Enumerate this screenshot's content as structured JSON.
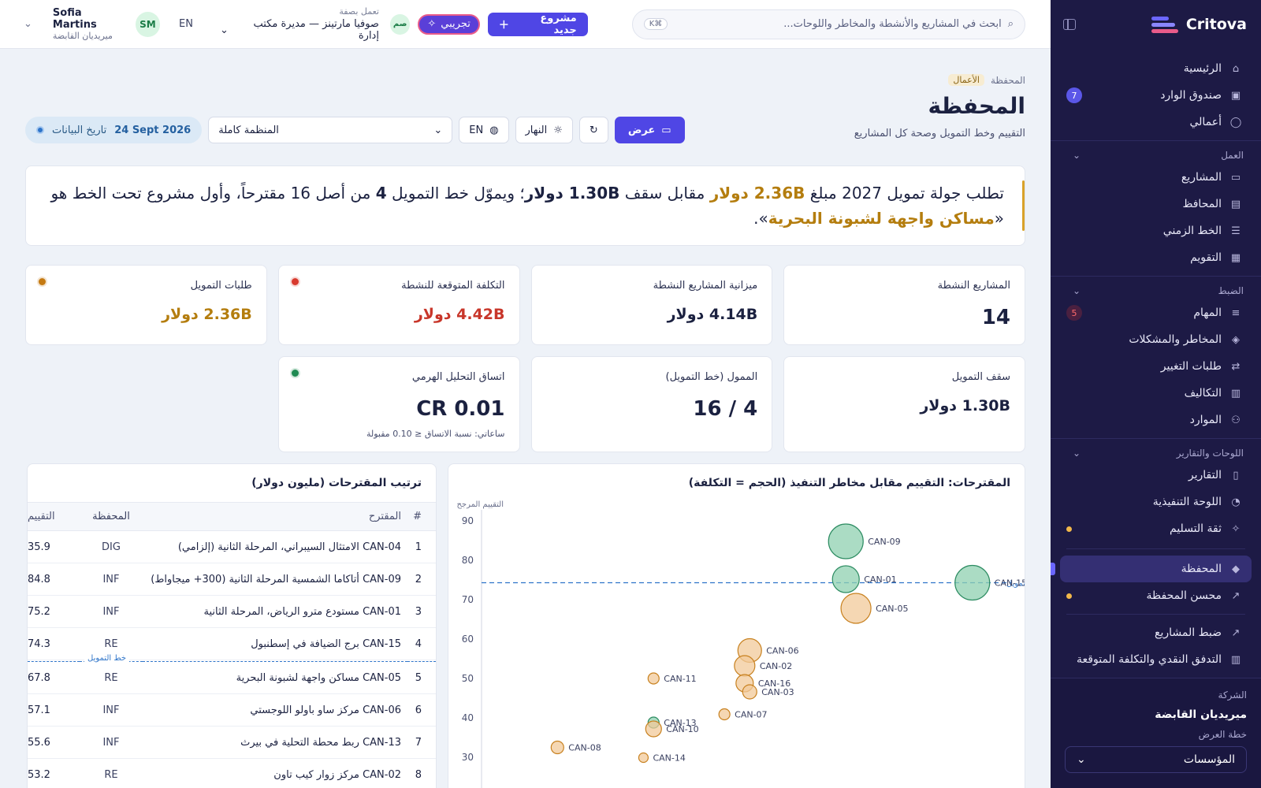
{
  "sidebar": {
    "brand": "Critova",
    "items_top": [
      {
        "label": "الرئيسية",
        "icon": "home-icon"
      },
      {
        "label": "صندوق الوارد",
        "icon": "inbox-icon",
        "count": "7"
      },
      {
        "label": "أعمالي",
        "icon": "user-icon"
      }
    ],
    "sections": [
      {
        "title": "العمل",
        "items": [
          {
            "label": "المشاريع",
            "icon": "folder-icon"
          },
          {
            "label": "المحافظ",
            "icon": "briefcase-icon"
          },
          {
            "label": "الخط الزمني",
            "icon": "timeline-icon"
          },
          {
            "label": "التقويم",
            "icon": "calendar-icon"
          }
        ]
      },
      {
        "title": "الضبط",
        "items": [
          {
            "label": "المهام",
            "icon": "list-icon",
            "count": "5"
          },
          {
            "label": "المخاطر والمشكلات",
            "icon": "shield-icon"
          },
          {
            "label": "طلبات التغيير",
            "icon": "swap-icon"
          },
          {
            "label": "التكاليف",
            "icon": "money-icon"
          },
          {
            "label": "الموارد",
            "icon": "people-icon"
          }
        ]
      },
      {
        "title": "اللوحات والتقارير",
        "items": [
          {
            "label": "التقارير",
            "icon": "report-icon"
          },
          {
            "label": "اللوحة التنفيذية",
            "icon": "gauge-icon"
          },
          {
            "label": "ثقة التسليم",
            "icon": "target-icon",
            "dot": true
          }
        ]
      }
    ],
    "active": {
      "label": "المحفظة",
      "icon": "layers-icon"
    },
    "items_after": [
      {
        "label": "محسن المحفظة",
        "icon": "chart-line-icon",
        "dot": true
      },
      {
        "label": "ضبط المشاريع",
        "icon": "chart-line-icon"
      },
      {
        "label": "التدفق النقدي والتكلفة المتوقعة",
        "icon": "money-icon"
      }
    ],
    "footer": {
      "company_label": "الشركة",
      "company": "ميريديان القابضة",
      "plan_label": "خطة العرض",
      "plan_value": "المؤسسات"
    }
  },
  "topbar": {
    "search_placeholder": "ابحث في المشاريع والأنشطة والمخاطر واللوحات...",
    "search_shortcut": "⌘K",
    "new_project": "مشروع جديد",
    "trial": "تجريبي",
    "acting_as_label": "تعمل بصفة",
    "acting_as": "صوفيا مارتينز — مديرة مكتب إدارة",
    "acting_initials": "صم",
    "lang": "EN",
    "user_initials": "SM",
    "user_name": "Sofia Martins",
    "user_org": "ميريديان القابضة"
  },
  "page": {
    "crumb_root": "المحفظة",
    "crumb_tag": "الأعمال",
    "title": "المحفظة",
    "subtitle": "التقييم وخط التمويل وصحة كل المشاريع",
    "date_label": "تاريخ البيانات",
    "date_value": "24 Sept 2026",
    "scope": "المنظمة كاملة",
    "lang": "EN",
    "theme": "النهار",
    "view": "عرض"
  },
  "insight": {
    "p1": "تطلب جولة تمويل 2027 مبلغ ",
    "amount": "2.36B دولار",
    "p2": " مقابل سقف ",
    "cap": "1.30B دولار",
    "p3": "؛ ويموّل خط التمويل ",
    "funded": "4",
    "p4": " من أصل 16 مقترحاً، وأول مشروع تحت الخط هو «",
    "first_below": "مساكن واجهة لشبونة البحرية",
    "p5": "»."
  },
  "kpis": [
    {
      "title": "المشاريع النشطة",
      "value": "14",
      "big": true
    },
    {
      "title": "ميزانية المشاريع النشطة",
      "value": "4.14B دولار"
    },
    {
      "title": "التكلفة المتوقعة للنشطة",
      "value": "4.42B دولار",
      "tone": "red",
      "dot": "#d83a2e"
    },
    {
      "title": "طلبات التمويل",
      "value": "2.36B دولار",
      "tone": "amber",
      "dot": "#c57a12"
    },
    {
      "title": "سقف التمويل",
      "value": "1.30B دولار"
    },
    {
      "title": "الممول (خط التمويل)",
      "value": "4 / 16",
      "big": true
    },
    {
      "title": "اتساق التحليل الهرمي",
      "value": "CR 0.01",
      "big": true,
      "note": "ساعاتي: نسبة الاتساق ≤ 0.10 مقبولة",
      "dot": "#1f8a52"
    }
  ],
  "table": {
    "title": "ترتيب المقترحات (مليون دولار)",
    "headers": {
      "rank": "#",
      "name": "المقترح",
      "portfolio": "المحفظة",
      "score": "التقييم"
    },
    "funding_line": "خط التمويل",
    "rows": [
      {
        "rank": "1",
        "name": "CAN-04 الامتثال السيبراني، المرحلة الثانية (إلزامي)",
        "portfolio": "DIG",
        "score": "35.9"
      },
      {
        "rank": "2",
        "name": "CAN-09 أتاكاما الشمسية المرحلة الثانية (300+ ميجاواط)",
        "portfolio": "INF",
        "score": "84.8"
      },
      {
        "rank": "3",
        "name": "CAN-01 مستودع مترو الرياض، المرحلة الثانية",
        "portfolio": "INF",
        "score": "75.2"
      },
      {
        "rank": "4",
        "name": "CAN-15 برج الضيافة في إسطنبول",
        "portfolio": "RE",
        "score": "74.3"
      },
      {
        "rank": "5",
        "name": "CAN-05 مساكن واجهة لشبونة البحرية",
        "portfolio": "RE",
        "score": "67.8"
      },
      {
        "rank": "6",
        "name": "CAN-06 مركز ساو باولو اللوجستي",
        "portfolio": "INF",
        "score": "57.1"
      },
      {
        "rank": "7",
        "name": "CAN-13 ربط محطة التحلية في بيرث",
        "portfolio": "INF",
        "score": "55.6"
      },
      {
        "rank": "8",
        "name": "CAN-02 مركز زوار كيب تاون",
        "portfolio": "RE",
        "score": "53.2"
      }
    ]
  },
  "chart_data": {
    "type": "scatter",
    "title": "المقترحات: التقييم مقابل مخاطر التنفيذ (الحجم = التكلفة)",
    "ylabel": "التقييم المرجح",
    "ylim": [
      25,
      90
    ],
    "yticks": [
      30,
      40,
      50,
      60,
      70,
      80,
      90
    ],
    "funding_line": {
      "y": 74.3,
      "label": "خط التمويل"
    },
    "points": [
      {
        "label": "CAN-09",
        "x": 0.72,
        "y": 84.8,
        "r": 22,
        "funded": true
      },
      {
        "label": "CAN-01",
        "x": 0.72,
        "y": 75.2,
        "r": 17,
        "funded": true
      },
      {
        "label": "CAN-15",
        "x": 0.97,
        "y": 74.3,
        "r": 22,
        "funded": true
      },
      {
        "label": "CAN-05",
        "x": 0.74,
        "y": 67.8,
        "r": 19,
        "funded": false
      },
      {
        "label": "CAN-06",
        "x": 0.53,
        "y": 57.1,
        "r": 15,
        "funded": false
      },
      {
        "label": "CAN-02",
        "x": 0.52,
        "y": 53.2,
        "r": 13,
        "funded": false
      },
      {
        "label": "CAN-11",
        "x": 0.34,
        "y": 50.0,
        "r": 7,
        "funded": false
      },
      {
        "label": "CAN-16",
        "x": 0.52,
        "y": 48.8,
        "r": 11,
        "funded": false
      },
      {
        "label": "CAN-03",
        "x": 0.53,
        "y": 46.6,
        "r": 9,
        "funded": false
      },
      {
        "label": "CAN-07",
        "x": 0.48,
        "y": 40.9,
        "r": 7,
        "funded": false
      },
      {
        "label": "CAN-13",
        "x": 0.34,
        "y": 38.8,
        "r": 7,
        "funded": true
      },
      {
        "label": "CAN-10",
        "x": 0.34,
        "y": 37.2,
        "r": 10,
        "funded": false
      },
      {
        "label": "CAN-08",
        "x": 0.15,
        "y": 32.5,
        "r": 8,
        "funded": false
      },
      {
        "label": "CAN-14",
        "x": 0.32,
        "y": 29.9,
        "r": 6,
        "funded": false
      }
    ],
    "colors": {
      "funded": "#8fd0b0",
      "funded_stroke": "#2d8c62",
      "unfunded": "#f2c99a",
      "unfunded_stroke": "#c8811f",
      "line": "#2e74c9"
    }
  }
}
